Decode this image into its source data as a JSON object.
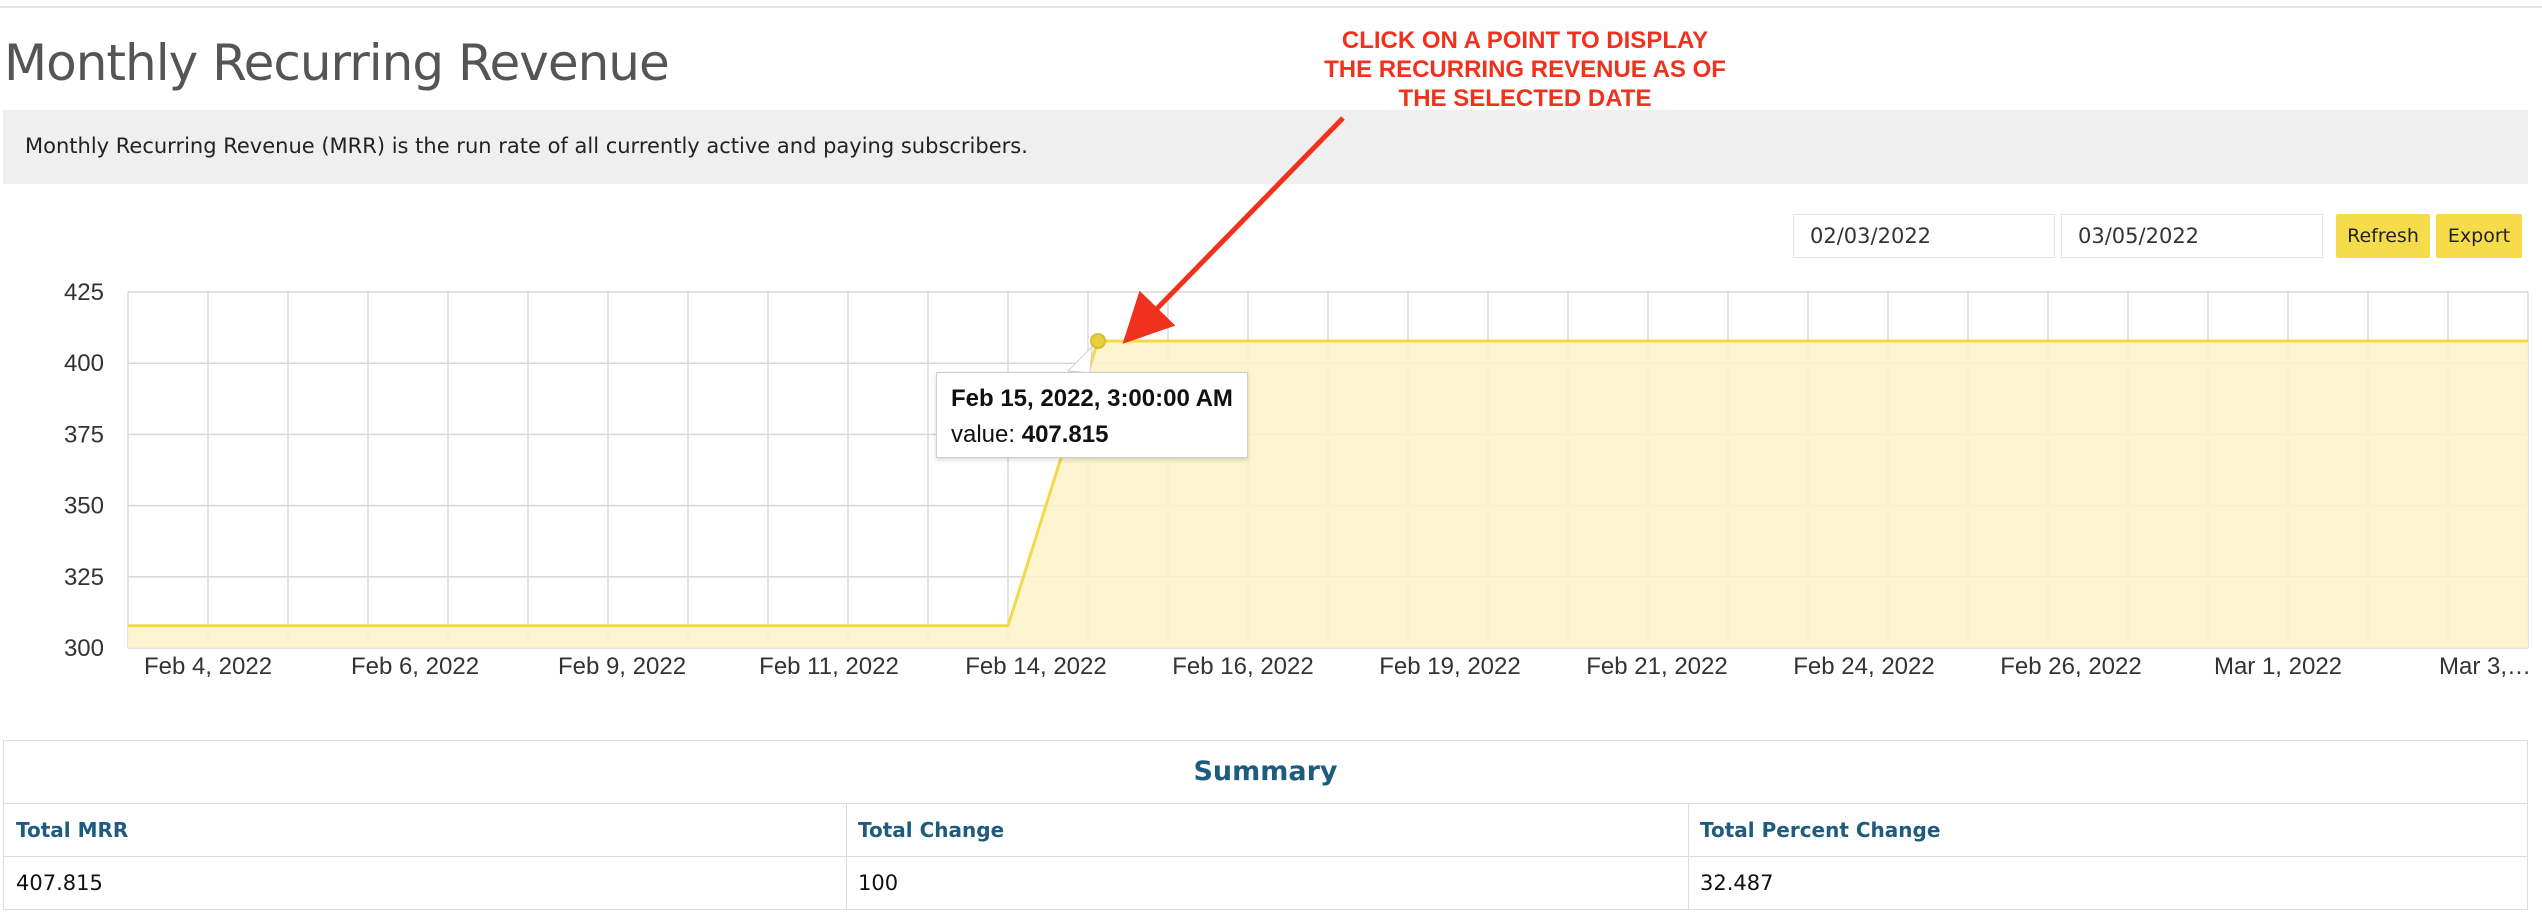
{
  "page": {
    "title": "Monthly Recurring Revenue",
    "description": "Monthly Recurring Revenue (MRR) is the run rate of all currently active and paying subscribers."
  },
  "controls": {
    "start_date": "02/03/2022",
    "end_date": "03/05/2022",
    "refresh_label": "Refresh",
    "export_label": "Export"
  },
  "annotation": {
    "lines": [
      "CLICK ON A POINT TO DISPLAY",
      "THE RECURRING REVENUE AS OF",
      "THE SELECTED DATE"
    ],
    "color": "#f0311e"
  },
  "tooltip": {
    "title": "Feb 15, 2022, 3:00:00 AM",
    "value_label": "value:",
    "value": "407.815"
  },
  "chart_data": {
    "type": "area",
    "x_tick_labels": [
      "Feb 4, 2022",
      "Feb 6, 2022",
      "Feb 9, 2022",
      "Feb 11, 2022",
      "Feb 14, 2022",
      "Feb 16, 2022",
      "Feb 19, 2022",
      "Feb 21, 2022",
      "Feb 24, 2022",
      "Feb 26, 2022",
      "Mar 1, 2022",
      "Mar 3,…"
    ],
    "y_ticks": [
      300,
      325,
      350,
      375,
      400,
      425
    ],
    "ylim": [
      300,
      425
    ],
    "xlim": [
      "2022-02-03",
      "2022-03-05"
    ],
    "series": [
      {
        "points": [
          {
            "x": "2022-02-03",
            "y": 307.815
          },
          {
            "x": "2022-02-14",
            "y": 307.815
          },
          {
            "x": "2022-02-15T03:00",
            "y": 407.815
          },
          {
            "x": "2022-03-05",
            "y": 407.815
          }
        ]
      }
    ],
    "highlight_point": {
      "x": "2022-02-15T03:00",
      "y": 407.815
    },
    "grid": true,
    "line_color": "#f3d94a",
    "fill_color": "#fdf3c8"
  },
  "summary": {
    "title": "Summary",
    "headers": [
      "Total MRR",
      "Total Change",
      "Total Percent Change"
    ],
    "values": [
      "407.815",
      "100",
      "32.487"
    ]
  }
}
